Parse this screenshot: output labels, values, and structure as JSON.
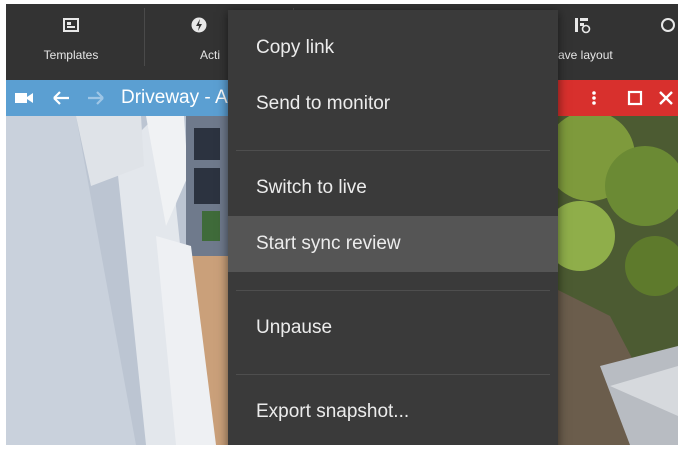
{
  "toolbar": {
    "templates_label": "Templates",
    "actions_label": "Acti",
    "save_layout_label": "Save layout"
  },
  "tile_left": {
    "title": "Driveway - A"
  },
  "context_menu": {
    "items": [
      {
        "label": "Copy link"
      },
      {
        "label": "Send to monitor"
      },
      {
        "label": "Switch to live"
      },
      {
        "label": "Start sync review"
      },
      {
        "label": "Unpause"
      },
      {
        "label": "Export snapshot..."
      }
    ],
    "highlighted_index": 3
  },
  "colors": {
    "toolbar_bg": "#333333",
    "tile_bar_blue": "#5b9fd2",
    "tile_bar_red": "#d8302d",
    "menu_bg": "#3a3a3a",
    "menu_highlight": "#555555"
  },
  "icons": {
    "templates": "templates-icon",
    "actions": "actions-icon",
    "save_layout": "save-layout-icon",
    "camera": "camera-icon",
    "back": "back-arrow-icon",
    "forward": "forward-arrow-icon",
    "more": "more-vertical-icon",
    "maximize": "maximize-icon",
    "close": "close-icon"
  }
}
